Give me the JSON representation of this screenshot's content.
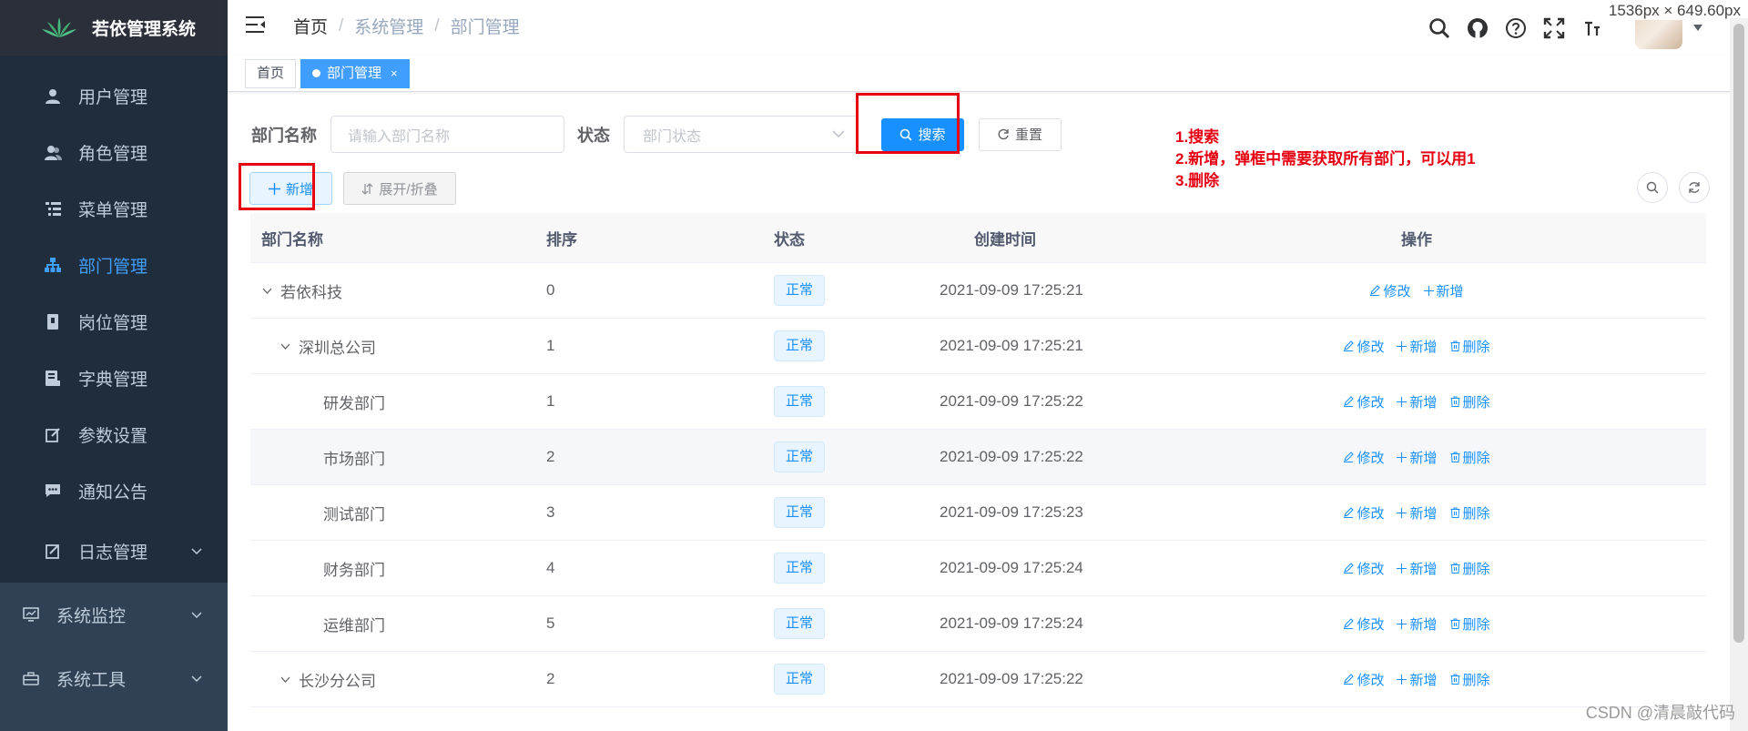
{
  "app": {
    "title": "若依管理系统"
  },
  "sidebar": {
    "items": [
      {
        "label": "用户管理",
        "icon": "user-icon"
      },
      {
        "label": "角色管理",
        "icon": "peoples-icon"
      },
      {
        "label": "菜单管理",
        "icon": "tree-table-icon"
      },
      {
        "label": "部门管理",
        "icon": "tree-icon",
        "active": true
      },
      {
        "label": "岗位管理",
        "icon": "post-icon"
      },
      {
        "label": "字典管理",
        "icon": "dict-icon"
      },
      {
        "label": "参数设置",
        "icon": "edit-icon"
      },
      {
        "label": "通知公告",
        "icon": "message-icon"
      },
      {
        "label": "日志管理",
        "icon": "log-icon"
      }
    ],
    "groups": [
      {
        "label": "系统监控",
        "icon": "monitor-icon"
      },
      {
        "label": "系统工具",
        "icon": "tool-icon"
      }
    ]
  },
  "header": {
    "breadcrumb": [
      "首页",
      "系统管理",
      "部门管理"
    ],
    "dimension_text": "1536px × 649.60px"
  },
  "tags": {
    "home": "首页",
    "current": "部门管理",
    "close": "×"
  },
  "search": {
    "dept_label": "部门名称",
    "dept_placeholder": "请输入部门名称",
    "status_label": "状态",
    "status_placeholder": "部门状态",
    "search_button": "搜索",
    "reset_button": "重置"
  },
  "toolbar": {
    "add_button": "新增",
    "expand_button": "展开/折叠"
  },
  "annotation": {
    "line1": "1.搜索",
    "line2": "2.新增，弹框中需要获取所有部门，可以用1",
    "line3": "3.删除"
  },
  "table": {
    "columns": [
      "部门名称",
      "排序",
      "状态",
      "创建时间",
      "操作"
    ],
    "op_labels": {
      "edit": "修改",
      "add": "新增",
      "delete": "删除"
    },
    "rows": [
      {
        "name": "若依科技",
        "sort": "0",
        "status": "正常",
        "time": "2021-09-09 17:25:21"
      },
      {
        "name": "深圳总公司",
        "sort": "1",
        "status": "正常",
        "time": "2021-09-09 17:25:21"
      },
      {
        "name": "研发部门",
        "sort": "1",
        "status": "正常",
        "time": "2021-09-09 17:25:22"
      },
      {
        "name": "市场部门",
        "sort": "2",
        "status": "正常",
        "time": "2021-09-09 17:25:22"
      },
      {
        "name": "测试部门",
        "sort": "3",
        "status": "正常",
        "time": "2021-09-09 17:25:23"
      },
      {
        "name": "财务部门",
        "sort": "4",
        "status": "正常",
        "time": "2021-09-09 17:25:24"
      },
      {
        "name": "运维部门",
        "sort": "5",
        "status": "正常",
        "time": "2021-09-09 17:25:24"
      },
      {
        "name": "长沙分公司",
        "sort": "2",
        "status": "正常",
        "time": "2021-09-09 17:25:22"
      }
    ]
  },
  "watermark": "CSDN @清晨敲代码",
  "colors": {
    "sidebar_bg": "#304156",
    "primary": "#1890ff",
    "annotation": "#e60012"
  }
}
